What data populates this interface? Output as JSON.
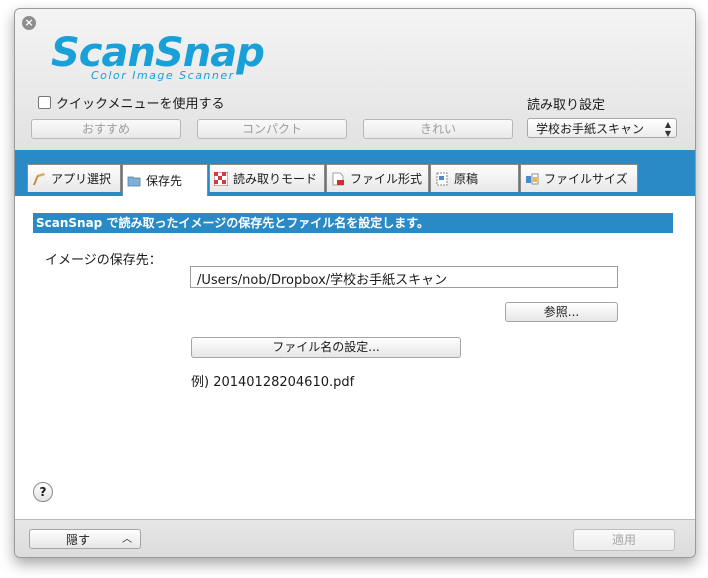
{
  "header": {
    "logo_main": "ScanSnap",
    "logo_sub": "Color Image Scanner",
    "quick_menu_label": "クイックメニューを使用する",
    "presets": [
      "おすすめ",
      "コンパクト",
      "きれい"
    ],
    "settings_label": "読み取り設定",
    "settings_value": "学校お手紙スキャン"
  },
  "tabs": [
    {
      "label": "アプリ選択",
      "icon": "pen-icon"
    },
    {
      "label": "保存先",
      "icon": "folder-icon"
    },
    {
      "label": "読み取りモード",
      "icon": "color-grid-icon"
    },
    {
      "label": "ファイル形式",
      "icon": "pdf-file-icon"
    },
    {
      "label": "原稿",
      "icon": "document-icon"
    },
    {
      "label": "ファイルサイズ",
      "icon": "filesize-icon"
    }
  ],
  "active_tab": 1,
  "panel": {
    "title": "ScanSnap で読み取ったイメージの保存先とファイル名を設定します。",
    "dest_label": "イメージの保存先：",
    "path_value": "/Users/nob/Dropbox/学校お手紙スキャン",
    "browse_label": "参照...",
    "filename_btn": "ファイル名の設定...",
    "example": "例) 20140128204610.pdf"
  },
  "footer": {
    "hide_label": "隠す",
    "apply_label": "適用"
  },
  "colors": {
    "accent": "#2a8ac5",
    "logo": "#1aa0d8"
  }
}
